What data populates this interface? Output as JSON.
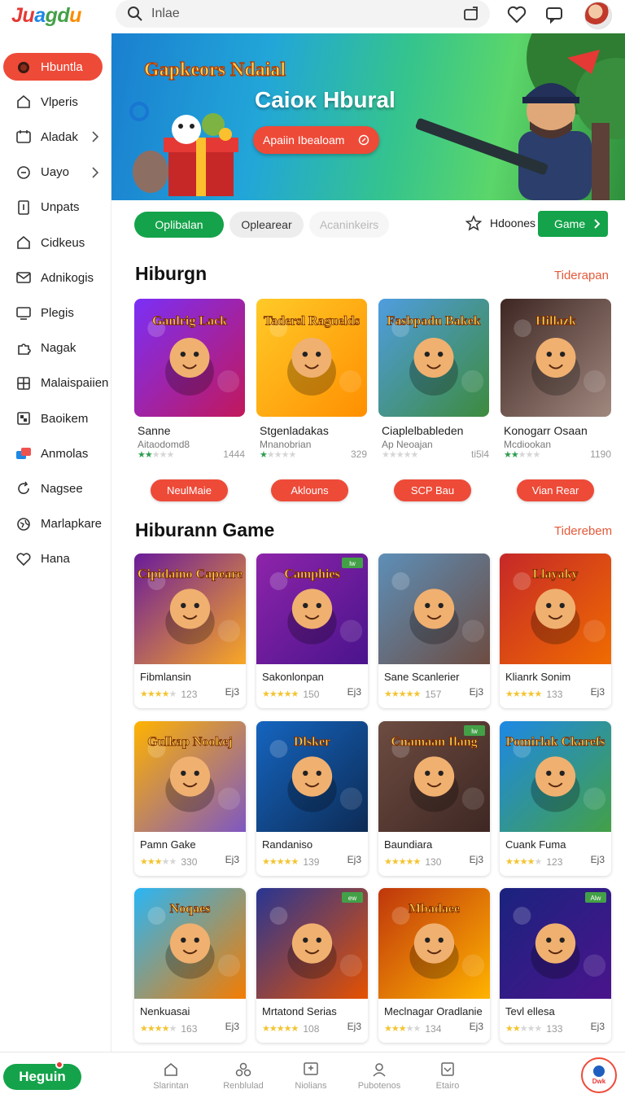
{
  "app": {
    "logo": [
      "Ju",
      "a",
      "gd",
      "u"
    ],
    "search_value": "Inlae"
  },
  "sidebar": {
    "items": [
      {
        "label": "Hbuntla",
        "icon": "game-icon",
        "active": true
      },
      {
        "label": "Vlperis",
        "icon": "home-icon"
      },
      {
        "label": "Aladak",
        "icon": "calendar-icon",
        "chevron": true
      },
      {
        "label": "Uayo",
        "icon": "chat-icon",
        "chevron": true
      },
      {
        "label": "Unpats",
        "icon": "document-icon"
      },
      {
        "label": "Cidkeus",
        "icon": "home-icon"
      },
      {
        "label": "Adnikogis",
        "icon": "mail-icon"
      },
      {
        "label": "Plegis",
        "icon": "monitor-icon"
      },
      {
        "label": "Nagak",
        "icon": "puzzle-icon"
      },
      {
        "label": "Malaispaiien",
        "icon": "grid-icon"
      },
      {
        "label": "Baoikem",
        "icon": "board-icon"
      },
      {
        "label": "Anmolas",
        "icon": "cards-icon"
      },
      {
        "label": "Nagsee",
        "icon": "refresh-icon"
      },
      {
        "label": "Marlapkare",
        "icon": "globe-icon"
      },
      {
        "label": "Hana",
        "icon": "heart-icon"
      }
    ]
  },
  "hero": {
    "art_title": "Gapkeors Ndaial",
    "title": "Caioκ Hbural",
    "button_label": "Apaiin Ibealoam"
  },
  "filters": {
    "tabs": [
      "Oplibalan",
      "Oplearear",
      "Acaninkeirs"
    ],
    "favorites_label": "Hdoones",
    "game_button_label": "Game"
  },
  "section1": {
    "title": "Hiburgn",
    "link": "Tiderapan",
    "cards": [
      {
        "art": "Ganlrig Lack",
        "title": "Sanne",
        "subtitle": "Aitaodomd8",
        "rating": 2,
        "count": "1444",
        "button": "NeulMaie",
        "colors": [
          "#7b2ff7",
          "#c2185b"
        ]
      },
      {
        "art": "Tadersl Raguelds",
        "title": "Stgenladakas",
        "subtitle": "Mnanobrian",
        "rating": 1,
        "count": "329",
        "button": "Aklouns",
        "colors": [
          "#ffca28",
          "#ff8f00"
        ]
      },
      {
        "art": "Fasbpadu Bakek",
        "title": "Ciaplelbableden",
        "subtitle": "Ap Neoajan",
        "rating": 0,
        "count": "ti5l4",
        "button": "SCP Bau",
        "colors": [
          "#4f9de0",
          "#3d8b3d"
        ]
      },
      {
        "art": "Hillazk",
        "title": "Konogarr Osaan",
        "subtitle": "Mcdiookan",
        "rating": 2,
        "count": "1190",
        "button": "Vian Rear",
        "colors": [
          "#3e2723",
          "#a1887f"
        ]
      }
    ]
  },
  "section2": {
    "title": "Hiburann Game",
    "link": "Tiderebem",
    "cards": [
      {
        "art": "Cipidaino Capeare",
        "title": "Fibmlansin",
        "rating": 4,
        "count": "123",
        "badge": "",
        "colors": [
          "#6a1b9a",
          "#f9a825"
        ]
      },
      {
        "art": "Camphies",
        "title": "Sakonlonpan",
        "rating": 5,
        "count": "150",
        "badge": "lw",
        "colors": [
          "#8e24aa",
          "#4a148c"
        ]
      },
      {
        "art": "",
        "title": "Sane Scanlerier",
        "rating": 5,
        "count": "157",
        "badge": "",
        "colors": [
          "#5d8fb8",
          "#6d4c41"
        ]
      },
      {
        "art": "Llayaky",
        "title": "Klianrk Sonim",
        "rating": 5,
        "count": "133",
        "badge": "",
        "colors": [
          "#c62828",
          "#ef6c00"
        ]
      },
      {
        "art": "Gulkap Nookej",
        "title": "Pamn Gake",
        "rating": 3,
        "count": "330",
        "badge": "",
        "colors": [
          "#ffb300",
          "#7e57c2"
        ]
      },
      {
        "art": "Dlsker",
        "title": "Randaniso",
        "rating": 5,
        "count": "139",
        "badge": "",
        "colors": [
          "#1565c0",
          "#0d2b55"
        ]
      },
      {
        "art": "Cnamaan Ilang",
        "title": "Baundiara",
        "rating": 5,
        "count": "130",
        "badge": "lw",
        "colors": [
          "#6d4c41",
          "#3e2723"
        ]
      },
      {
        "art": "Pomirlak Ckarefs",
        "title": "Cuank Fuma",
        "rating": 4,
        "count": "123",
        "badge": "",
        "colors": [
          "#1e88e5",
          "#43a047"
        ]
      },
      {
        "art": "Noqaes",
        "title": "Nenkuasai",
        "rating": 4,
        "count": "163",
        "badge": "",
        "colors": [
          "#29b6f6",
          "#f57c00"
        ]
      },
      {
        "art": "",
        "title": "Mrtatond Serias",
        "rating": 5,
        "count": "108",
        "badge": "ew",
        "colors": [
          "#283593",
          "#e65100"
        ]
      },
      {
        "art": "Mbadaee",
        "title": "Meclnagar Oradlanie",
        "rating": 3,
        "count": "134",
        "badge": "",
        "colors": [
          "#bf360c",
          "#ffb300"
        ]
      },
      {
        "art": "",
        "title": "Tevl ellesa",
        "rating": 2,
        "count": "133",
        "badge": "Alw",
        "colors": [
          "#1a237e",
          "#4a148c"
        ]
      }
    ],
    "card_icon_label": "Ej3"
  },
  "bottom_nav": {
    "login_label": "Heguin",
    "items": [
      {
        "label": "Slarintan",
        "icon": "home-icon"
      },
      {
        "label": "Renblulad",
        "icon": "community-icon"
      },
      {
        "label": "Niolians",
        "icon": "screen-icon"
      },
      {
        "label": "Pubotenos",
        "icon": "user-icon"
      },
      {
        "label": "Etairo",
        "icon": "inbox-icon"
      }
    ],
    "fab_label": "Dwk"
  },
  "theme": {
    "accent_red": "#ee4a38",
    "accent_green": "#14a34a",
    "star_color": "#f4c430",
    "star_green": "#2e9e4f"
  }
}
